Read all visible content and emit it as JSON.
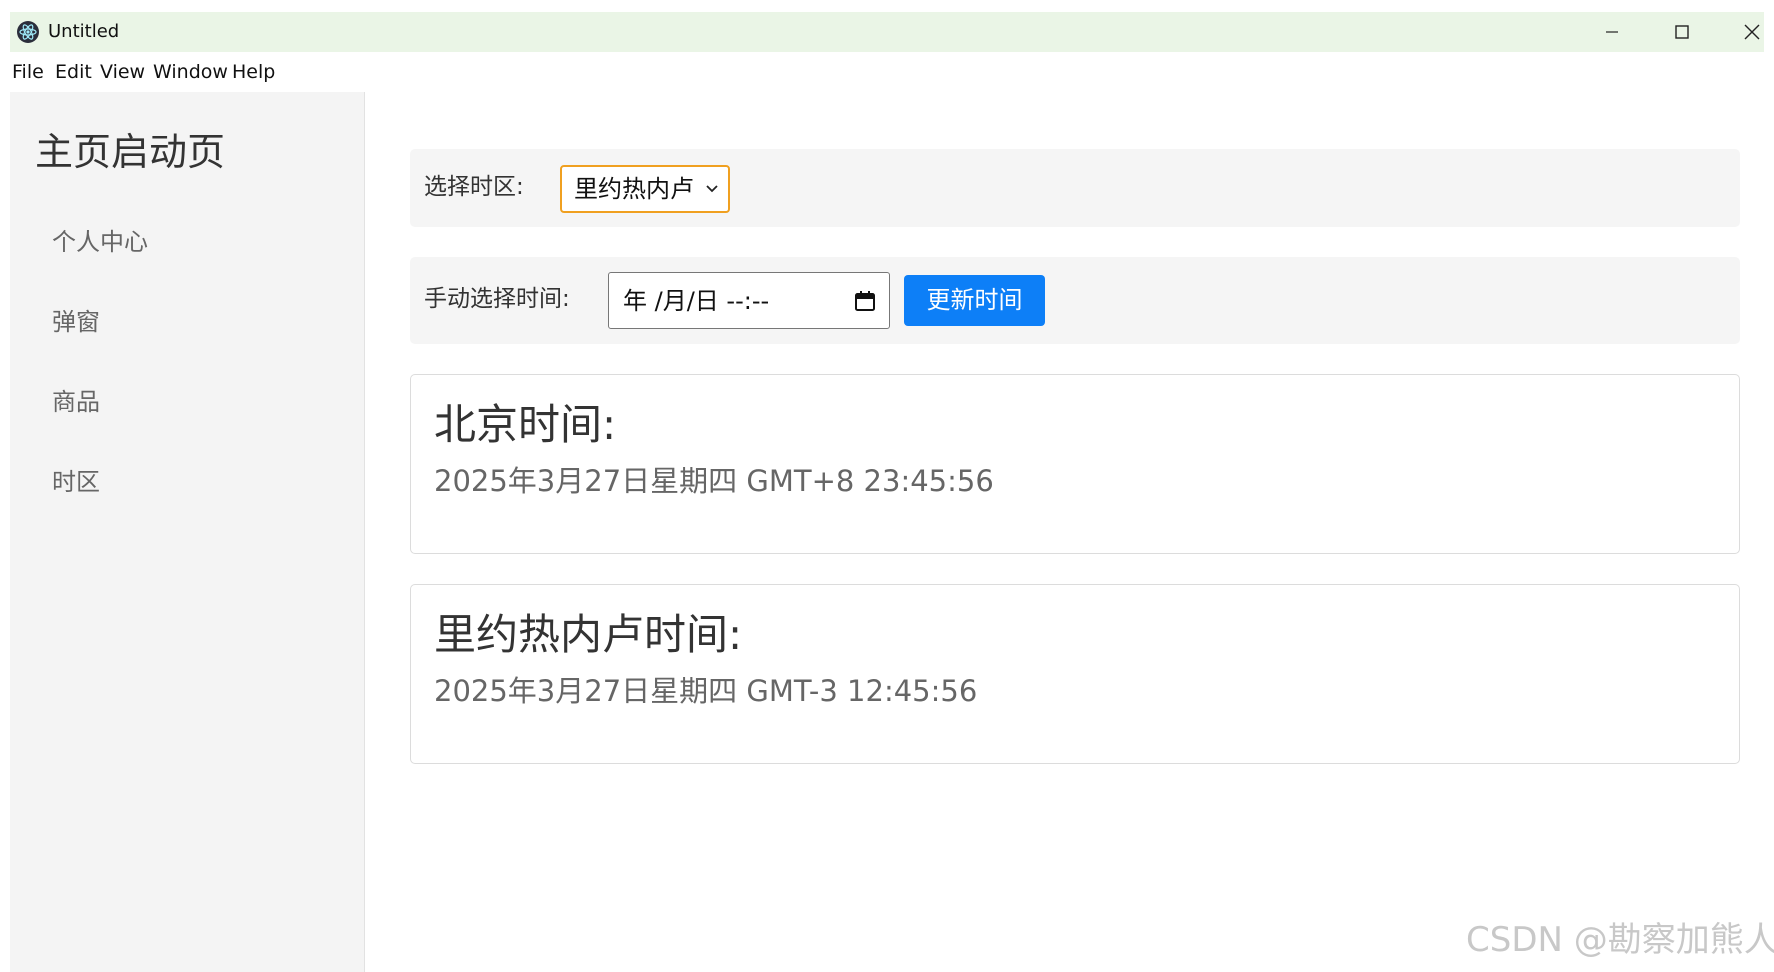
{
  "window": {
    "title": "Untitled"
  },
  "menu": {
    "items": [
      "File",
      "Edit",
      "View",
      "Window",
      "Help"
    ]
  },
  "sidebar": {
    "brand": "主页启动页",
    "items": [
      {
        "label": "个人中心"
      },
      {
        "label": "弹窗"
      },
      {
        "label": "商品"
      },
      {
        "label": "时区"
      }
    ]
  },
  "timezone": {
    "label": "选择时区:",
    "selected": "里约热内卢"
  },
  "manual_time": {
    "label": "手动选择时间:",
    "value": "年 /月/日 --:--",
    "button": "更新时间"
  },
  "cards": [
    {
      "title": "北京时间:",
      "time": "2025年3月27日星期四 GMT+8 23:45:56"
    },
    {
      "title": "里约热内卢时间:",
      "time": "2025年3月27日星期四 GMT-3 12:45:56"
    }
  ],
  "watermark": "CSDN @勘察加熊人",
  "colors": {
    "titlebar": "#eaf5e6",
    "accent_button": "#0d7ff7",
    "select_focus": "#f0a020",
    "sidebar_bg": "#f4f4f4"
  }
}
